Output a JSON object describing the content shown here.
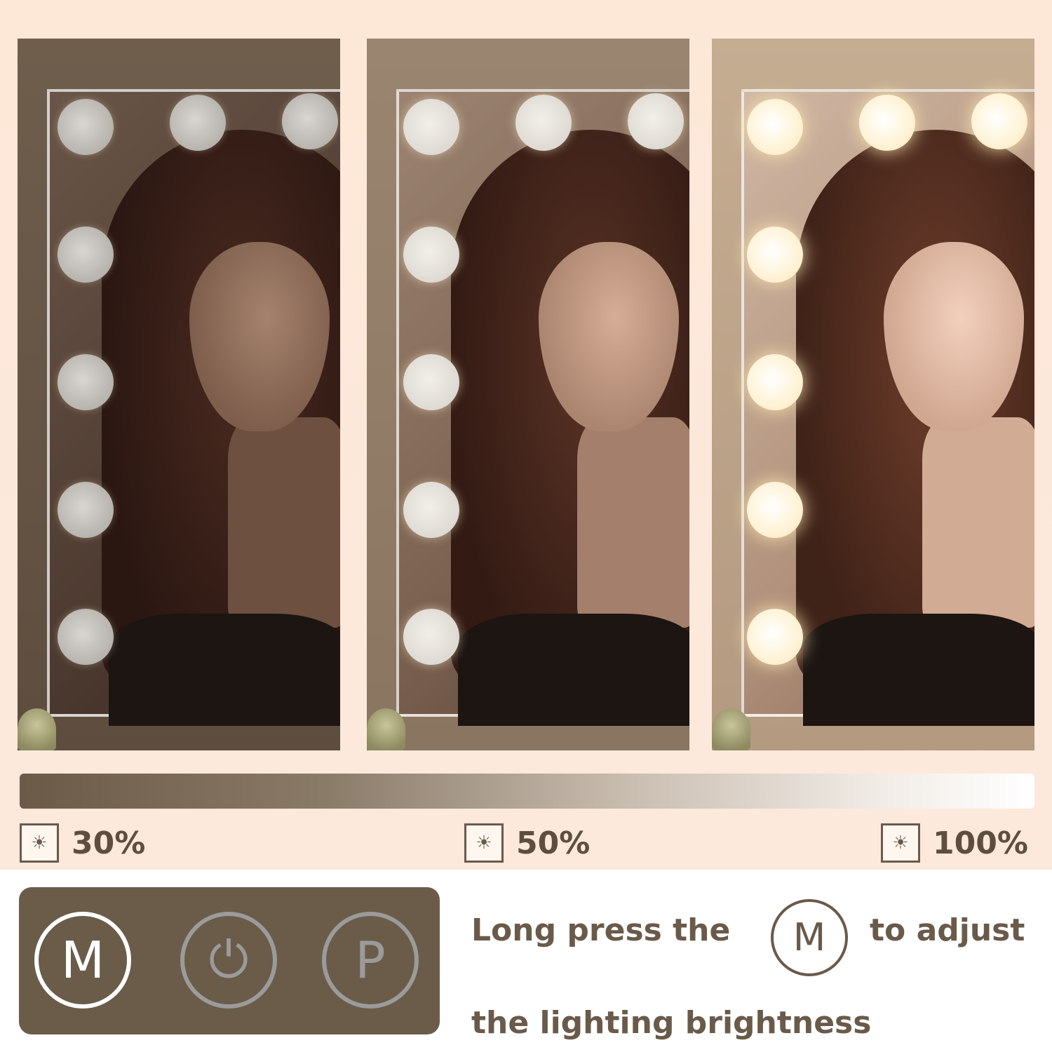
{
  "panels": [
    {
      "level": "30%"
    },
    {
      "level": "50%"
    },
    {
      "level": "100%"
    }
  ],
  "brightness_levels": {
    "low": "30%",
    "mid": "50%",
    "high": "100%"
  },
  "level_icon": "sun-brightness-icon",
  "controls": {
    "m_button": "M",
    "power_icon": "power-icon",
    "power_glyph": "⏻",
    "p_button": "P"
  },
  "instruction": {
    "part1": "Long press the",
    "button_label": "M",
    "part2": "to adjust",
    "line2": "the lighting brightness"
  },
  "colors": {
    "accent_brown": "#6a5a4a",
    "pad_bg": "#6b5c4a",
    "background": "#fde8d8"
  }
}
